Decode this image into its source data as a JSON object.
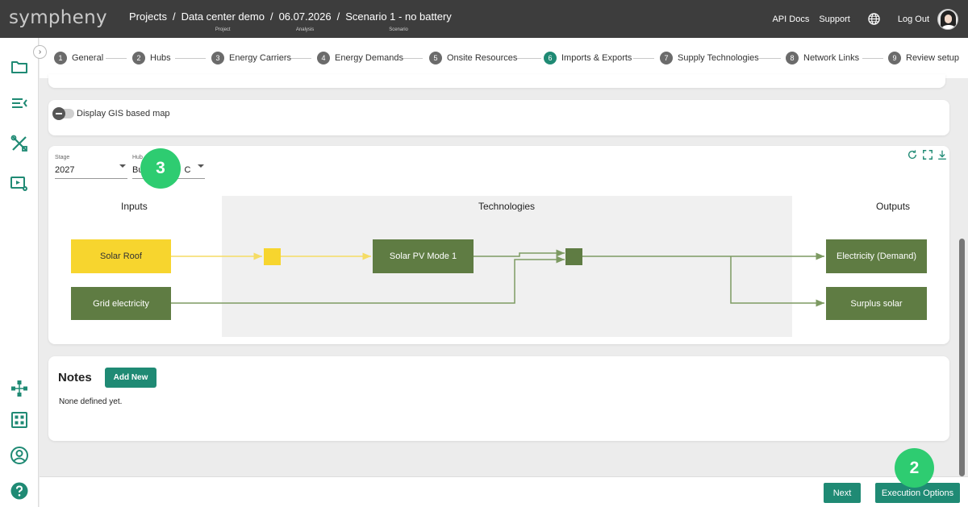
{
  "header": {
    "logo": "sympheny",
    "breadcrumbs": [
      {
        "label": "Projects",
        "sub": ""
      },
      {
        "label": "Data center demo",
        "sub": "Project"
      },
      {
        "label": "06.07.2026",
        "sub": "Analysis"
      },
      {
        "label": "Scenario 1 - no battery",
        "sub": "Scenario"
      }
    ],
    "api_docs": "API Docs",
    "support": "Support",
    "logout": "Log Out"
  },
  "stepper": {
    "collapse_glyph": "›",
    "active_step": 6,
    "steps": [
      {
        "num": "1",
        "label": "General"
      },
      {
        "num": "2",
        "label": "Hubs"
      },
      {
        "num": "3",
        "label": "Energy Carriers"
      },
      {
        "num": "4",
        "label": "Energy Demands"
      },
      {
        "num": "5",
        "label": "Onsite Resources"
      },
      {
        "num": "6",
        "label": "Imports & Exports"
      },
      {
        "num": "7",
        "label": "Supply Technologies"
      },
      {
        "num": "8",
        "label": "Network Links"
      },
      {
        "num": "9",
        "label": "Review setup"
      }
    ]
  },
  "gis": {
    "label": "Display GIS based map",
    "enabled": false
  },
  "diagram": {
    "stage_label": "Stage",
    "stage_value": "2027",
    "hub_label": "Hub",
    "hub_value_left": "Bu",
    "hub_value_right": "C",
    "inputs_title": "Inputs",
    "technologies_title": "Technologies",
    "outputs_title": "Outputs",
    "inputs": [
      "Solar Roof",
      "Grid electricity"
    ],
    "technologies": [
      "Solar PV Mode 1"
    ],
    "outputs": [
      "Electricity (Demand)",
      "Surplus solar"
    ],
    "colors": {
      "solar": "#f7d52e",
      "electricity": "#5f7c43",
      "solar_flow": "#f5dc64",
      "elec_flow": "#7d9a62"
    }
  },
  "markers": {
    "m3": "3",
    "m2": "2"
  },
  "notes": {
    "title": "Notes",
    "add_button": "Add New",
    "empty_text": "None defined yet."
  },
  "footer": {
    "next": "Next",
    "execution": "Execution Options"
  },
  "colors": {
    "accent": "#1f8a74",
    "marker": "#2ecc71",
    "topbar": "#3d3d3d"
  }
}
